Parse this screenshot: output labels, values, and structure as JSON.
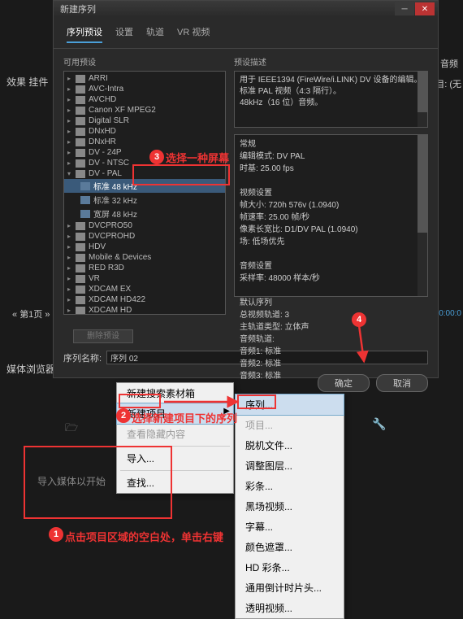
{
  "bg": {
    "effect_label": "效果 挂件",
    "audio_label": "音频",
    "target_label": "目: (无",
    "page_label": "第1页",
    "time": "0:00:0",
    "media_browser": "媒体浏览器",
    "import_hint": "导入媒体以开始"
  },
  "dialog": {
    "title": "新建序列",
    "tabs": [
      "序列预设",
      "设置",
      "轨道",
      "VR 视频"
    ],
    "left_label": "可用预设",
    "right_label": "预设描述",
    "presets": [
      "ARRI",
      "AVC-Intra",
      "AVCHD",
      "Canon XF MPEG2",
      "Digital SLR",
      "DNxHD",
      "DNxHR",
      "DV - 24P",
      "DV - NTSC",
      "DV - PAL",
      "标准 48 kHz",
      "标准 32 kHz",
      "宽屏 48 kHz",
      "DVCPRO50",
      "DVCPROHD",
      "HDV",
      "Mobile & Devices",
      "RED R3D",
      "VR",
      "XDCAM EX",
      "XDCAM HD422",
      "XDCAM HD"
    ],
    "dvpal_label": "DV - PAL",
    "desc1": "用于 IEEE1394 (FireWire/i.LINK) DV 设备的编辑。",
    "desc2": "标准 PAL 视频（4:3 隔行）。",
    "desc3": "48kHz（16 位）音频。",
    "general_h": "常规",
    "general1": "编辑模式: DV PAL",
    "general2": "时基: 25.00 fps",
    "video_h": "视频设置",
    "video1": "帧大小: 720h 576v (1.0940)",
    "video2": "帧速率: 25.00 帧/秒",
    "video3": "像素长宽比: D1/DV PAL (1.0940)",
    "video4": "场: 低场优先",
    "audio_h": "音频设置",
    "audio1": "采样率: 48000 样本/秒",
    "default_h": "默认序列",
    "default1": "总视频轨道: 3",
    "default2": "主轨道类型: 立体声",
    "default3": "音频轨道:",
    "default4": "音频1: 标准",
    "default5": "音频2: 标准",
    "default6": "音频3: 标准",
    "seq_name_label": "序列名称:",
    "seq_name_value": "序列 02",
    "disabled_btn": "删除预设",
    "ok": "确定",
    "cancel": "取消"
  },
  "menu1": {
    "newbin": "新建搜索素材箱",
    "newitem": "新建项目",
    "view": "查看隐藏内容",
    "import": "导入...",
    "find": "查找..."
  },
  "menu2": {
    "sequence": "序列...",
    "project": "项目...",
    "offline": "脱机文件...",
    "adjust": "调整图层...",
    "bars": "彩条...",
    "black": "黑场视频...",
    "caption": "字幕...",
    "color": "颜色遮罩...",
    "hdbars": "HD 彩条...",
    "countdown": "通用倒计时片头...",
    "trans": "透明视频..."
  },
  "annotations": {
    "n1": "1",
    "t1": "点击项目区域的空白处，单击右键",
    "n2": "2",
    "t2": "选择新建项目下的序列",
    "n3": "3",
    "t3": "选择一种屏幕",
    "n4": "4"
  }
}
